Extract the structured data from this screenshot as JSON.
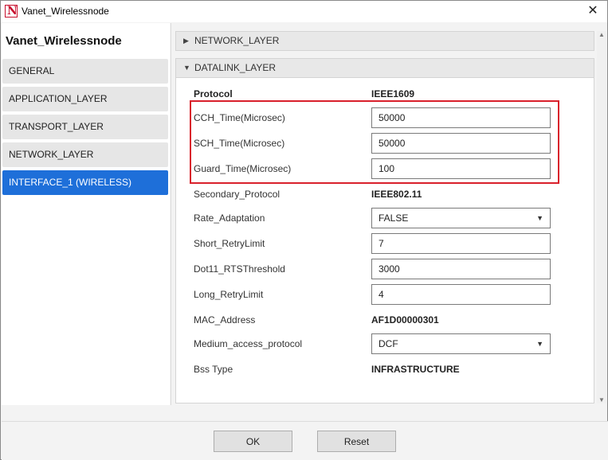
{
  "window": {
    "title": "Vanet_Wirelessnode",
    "app_icon": "netsim-logo-icon",
    "close_glyph": "✕"
  },
  "sidebar": {
    "title": "Vanet_Wirelessnode",
    "items": [
      {
        "label": "GENERAL",
        "active": false
      },
      {
        "label": "APPLICATION_LAYER",
        "active": false
      },
      {
        "label": "TRANSPORT_LAYER",
        "active": false
      },
      {
        "label": "NETWORK_LAYER",
        "active": false
      },
      {
        "label": "INTERFACE_1 (WIRELESS)",
        "active": true
      }
    ]
  },
  "sections": {
    "network": {
      "label": "NETWORK_LAYER",
      "expanded": false,
      "arrow": "▶"
    },
    "datalink": {
      "label": "DATALINK_LAYER",
      "expanded": true,
      "arrow": "▼"
    }
  },
  "datalink": {
    "protocol": {
      "label": "Protocol",
      "value": "IEEE1609"
    },
    "cch_time": {
      "label": "CCH_Time(Microsec)",
      "value": "50000"
    },
    "sch_time": {
      "label": "SCH_Time(Microsec)",
      "value": "50000"
    },
    "guard_time": {
      "label": "Guard_Time(Microsec)",
      "value": "100"
    },
    "secondary_protocol": {
      "label": "Secondary_Protocol",
      "value": "IEEE802.11"
    },
    "rate_adaptation": {
      "label": "Rate_Adaptation",
      "value": "FALSE"
    },
    "short_retry": {
      "label": "Short_RetryLimit",
      "value": "7"
    },
    "rts_threshold": {
      "label": "Dot11_RTSThreshold",
      "value": "3000"
    },
    "long_retry": {
      "label": "Long_RetryLimit",
      "value": "4"
    },
    "mac_address": {
      "label": "MAC_Address",
      "value": "AF1D00000301"
    },
    "medium_access": {
      "label": "Medium_access_protocol",
      "value": "DCF"
    },
    "bss_type": {
      "label": "Bss Type",
      "value": "INFRASTRUCTURE"
    },
    "caret": "▼"
  },
  "footer": {
    "ok_label": "OK",
    "reset_label": "Reset"
  },
  "colors": {
    "active_nav": "#1e6fd9",
    "highlight_border": "#d9202b",
    "logo_red": "#c8102e"
  }
}
